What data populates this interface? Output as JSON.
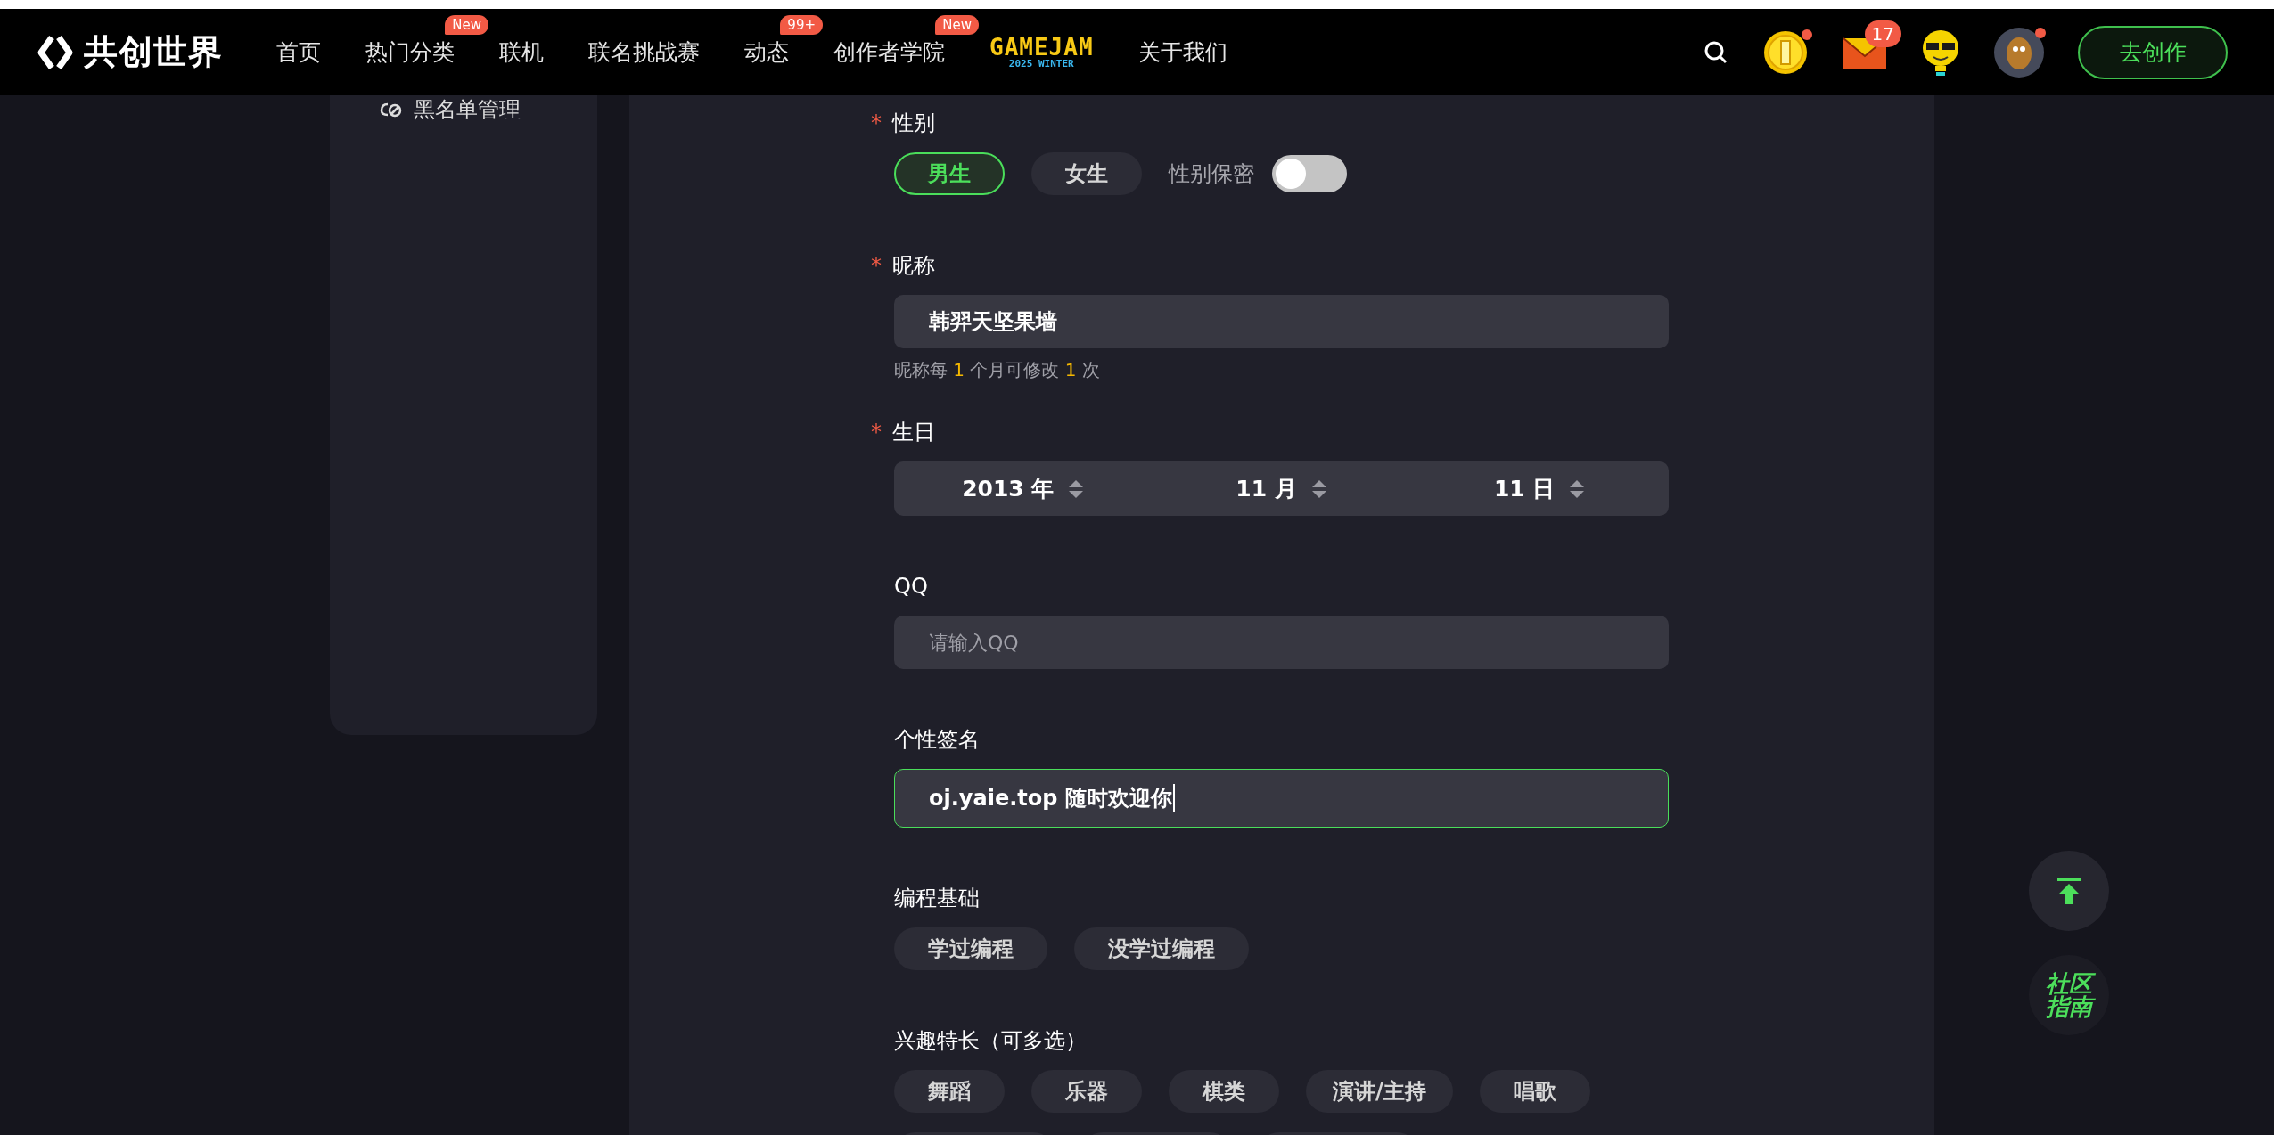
{
  "nav": {
    "brand": "共创世界",
    "items": [
      {
        "kind": "link",
        "label": "首页"
      },
      {
        "kind": "link",
        "label": "热门分类",
        "badge": "New"
      },
      {
        "kind": "link",
        "label": "联机"
      },
      {
        "kind": "link",
        "label": "联名挑战赛"
      },
      {
        "kind": "link",
        "label": "动态",
        "badge": "99+"
      },
      {
        "kind": "link",
        "label": "创作者学院",
        "badge": "New"
      },
      {
        "kind": "logo",
        "label": "GAMEJAM",
        "sublabel": "2025 WINTER"
      },
      {
        "kind": "link",
        "label": "关于我们"
      }
    ],
    "mail_badge": "17",
    "create_button": "去创作"
  },
  "sidebar": {
    "items": [
      {
        "label": "黑名单管理"
      }
    ]
  },
  "form": {
    "gender": {
      "mark": "*",
      "label": "性别",
      "options": [
        {
          "label": "男生",
          "selected": true
        },
        {
          "label": "女生",
          "selected": false
        }
      ],
      "secret_label": "性别保密",
      "secret_on": false
    },
    "nickname": {
      "mark": "*",
      "label": "昵称",
      "value": "韩羿天坚果墙",
      "hint": [
        {
          "kind": "text",
          "text": "昵称每 "
        },
        {
          "kind": "count",
          "text": "1"
        },
        {
          "kind": "text",
          "text": " 个月可修改 "
        },
        {
          "kind": "count",
          "text": "1"
        },
        {
          "kind": "text",
          "text": " 次"
        }
      ]
    },
    "birthday": {
      "mark": "*",
      "label": "生日",
      "parts": [
        "2013 年",
        "11 月",
        "11 日"
      ]
    },
    "qq": {
      "label": "QQ",
      "placeholder": "请输入QQ",
      "focused": false
    },
    "signature": {
      "label": "个性签名",
      "value": "oj.yaie.top 随时欢迎你",
      "focused": true
    },
    "coding": {
      "label": "编程基础",
      "options": [
        {
          "label": "学过编程",
          "selected": false
        },
        {
          "label": "没学过编程",
          "selected": false
        }
      ]
    },
    "interests": {
      "label": "兴趣特长（可多选）",
      "options": [
        {
          "label": "舞蹈",
          "selected": false
        },
        {
          "label": "乐器",
          "selected": false
        },
        {
          "label": "棋类",
          "selected": false
        },
        {
          "label": "演讲/主持",
          "selected": false
        },
        {
          "label": "唱歌",
          "selected": false
        }
      ]
    }
  },
  "guide_button": "社区指南"
}
